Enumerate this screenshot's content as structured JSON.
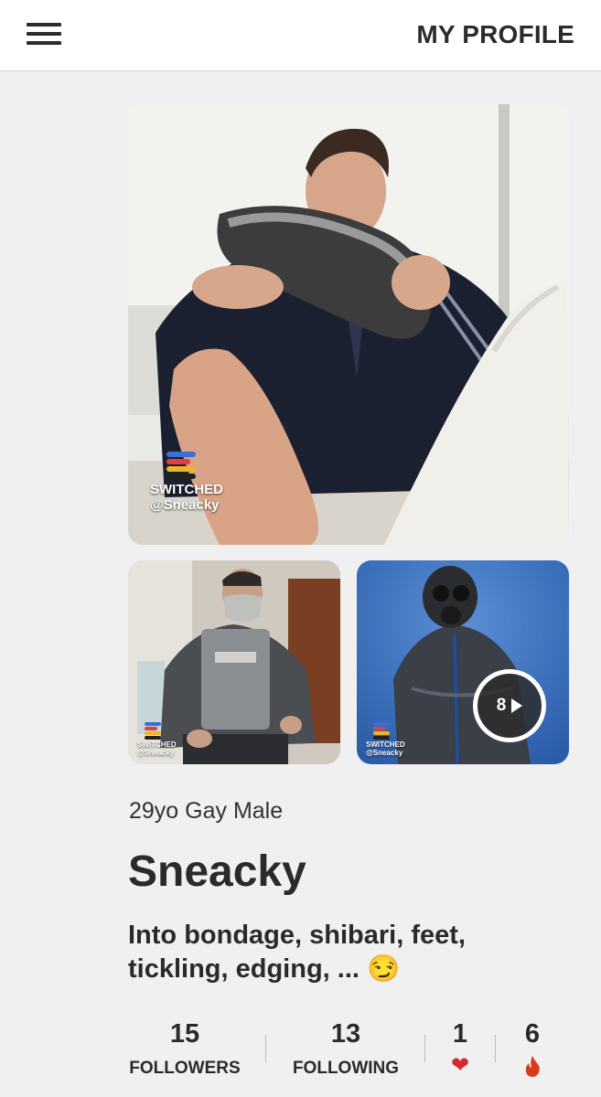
{
  "header": {
    "title": "MY PROFILE",
    "menu_icon": "hamburger-menu-icon"
  },
  "photos": {
    "main": {
      "watermark_brand": "SWITCHED",
      "watermark_handle": "@Sneacky"
    },
    "small_1": {
      "watermark_brand": "SWITCHED",
      "watermark_handle": "@Sneacky"
    },
    "small_2": {
      "watermark_brand": "SWITCHED",
      "watermark_handle": "@Sneacky",
      "more_count": "8",
      "more_icon": "play-icon"
    }
  },
  "profile": {
    "meta": "29yo Gay Male",
    "name": "Sneacky",
    "bio": "Into bondage, shibari, feet, tickling, edging, ... 😏"
  },
  "stats": {
    "followers": {
      "value": "15",
      "label": "FOLLOWERS"
    },
    "following": {
      "value": "13",
      "label": "FOLLOWING"
    },
    "likes": {
      "value": "1",
      "icon": "heart-icon"
    },
    "hot": {
      "value": "6",
      "icon": "flame-icon"
    }
  },
  "colors": {
    "background": "#f0f0f0",
    "header_bg": "#ffffff",
    "text": "#2a2a2a",
    "heart": "#d42a2a",
    "flame": "#d93a1e"
  }
}
